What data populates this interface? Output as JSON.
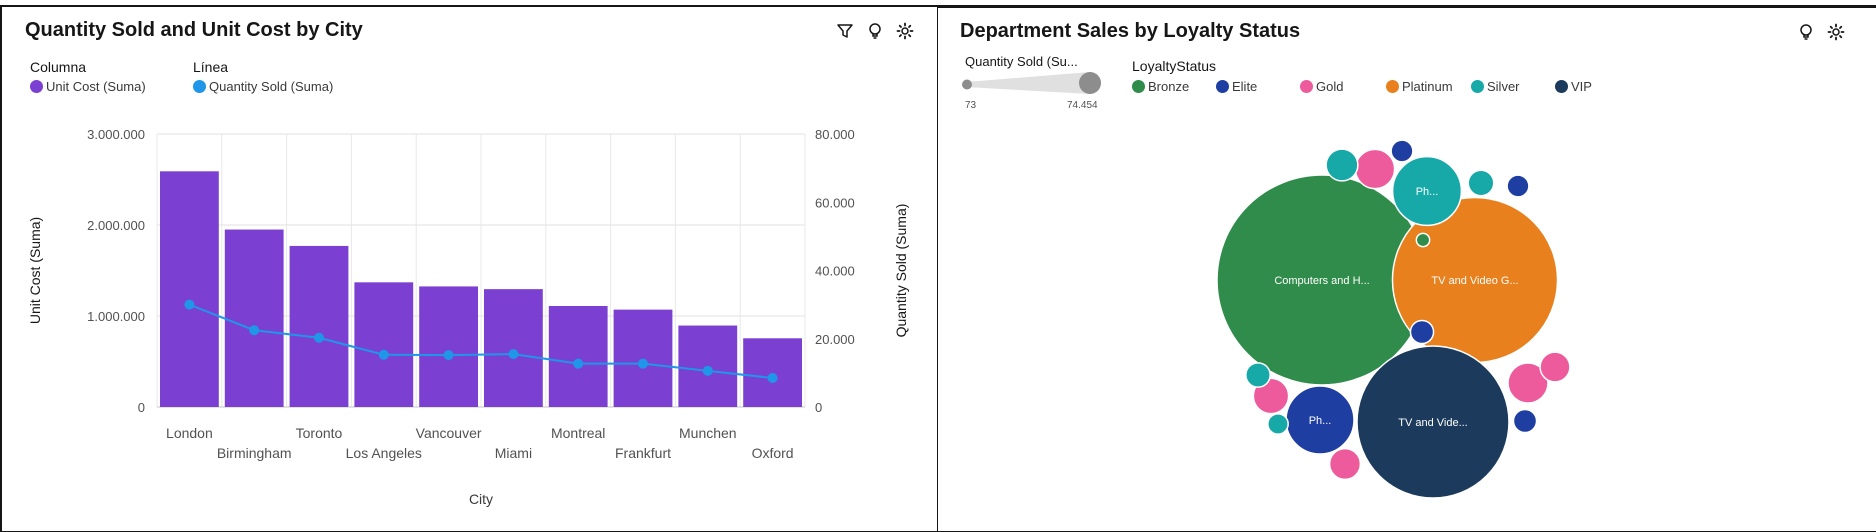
{
  "left_panel": {
    "title": "Quantity Sold and Unit Cost by City",
    "icons": [
      "filter-icon",
      "lightbulb-icon",
      "settings-icon"
    ],
    "legend": {
      "column_heading": "Columna",
      "column_item": "Unit Cost (Suma)",
      "line_heading": "Línea",
      "line_item": "Quantity Sold (Suma)"
    }
  },
  "right_panel": {
    "title": "Department Sales by Loyalty Status",
    "icons": [
      "lightbulb-icon",
      "settings-icon"
    ],
    "size_legend": {
      "title": "Quantity Sold (Su...",
      "min_label": "73",
      "max_label": "74.454"
    },
    "color_legend": {
      "title": "LoyaltyStatus",
      "items": [
        {
          "label": "Bronze",
          "color": "#2f8c4a"
        },
        {
          "label": "Elite",
          "color": "#1f3ea1"
        },
        {
          "label": "Gold",
          "color": "#ee5b9d"
        },
        {
          "label": "Platinum",
          "color": "#e7801d"
        },
        {
          "label": "Silver",
          "color": "#17a9a8"
        },
        {
          "label": "VIP",
          "color": "#1b3a5c"
        }
      ]
    }
  },
  "chart_data": [
    {
      "type": "bar",
      "title": "Quantity Sold and Unit Cost by City",
      "xlabel": "City",
      "ylabel": "Unit Cost (Suma)",
      "y2label": "Quantity Sold (Suma)",
      "categories": [
        "London",
        "Birmingham",
        "Toronto",
        "Los Angeles",
        "Vancouver",
        "Miami",
        "Montreal",
        "Frankfurt",
        "Munchen",
        "Oxford"
      ],
      "series": [
        {
          "name": "Unit Cost (Suma)",
          "type": "bar",
          "axis": "left",
          "color": "#7b3fd1",
          "values": [
            2590000,
            1950000,
            1770000,
            1370000,
            1325000,
            1295000,
            1110000,
            1070000,
            895000,
            755000
          ]
        },
        {
          "name": "Quantity Sold (Suma)",
          "type": "line",
          "axis": "right",
          "color": "#1f96e8",
          "values": [
            30000,
            22500,
            20300,
            15300,
            15200,
            15500,
            12700,
            12700,
            10600,
            8500
          ]
        }
      ],
      "ylim": [
        0,
        3000000
      ],
      "y2lim": [
        0,
        80000
      ],
      "yticks": [
        "0",
        "1.000.000",
        "2.000.000",
        "3.000.000"
      ],
      "y2ticks": [
        "0",
        "20.000",
        "40.000",
        "60.000",
        "80.000"
      ],
      "grid": true
    },
    {
      "type": "bubble",
      "title": "Department Sales by Loyalty Status",
      "size_measure": "Quantity Sold (Su...",
      "color_by": "LoyaltyStatus",
      "bubbles": [
        {
          "label": "Computers and H...",
          "status": "Bronze",
          "value": 74454
        },
        {
          "label": "TV and Video G...",
          "status": "Platinum",
          "value": 46000
        },
        {
          "label": "TV and Vide...",
          "status": "VIP",
          "value": 39000
        },
        {
          "label": "Ph...",
          "status": "Silver",
          "value": 8000
        },
        {
          "label": "Ph...",
          "status": "Elite",
          "value": 7800
        },
        {
          "label": "",
          "status": "Gold",
          "value": 2600
        },
        {
          "label": "",
          "status": "Gold",
          "value": 2700
        },
        {
          "label": "",
          "status": "Gold",
          "value": 2100
        },
        {
          "label": "",
          "status": "Gold",
          "value": 1600
        },
        {
          "label": "",
          "status": "Gold",
          "value": 1500
        },
        {
          "label": "",
          "status": "Silver",
          "value": 1700
        },
        {
          "label": "",
          "status": "Silver",
          "value": 1100
        },
        {
          "label": "",
          "status": "Silver",
          "value": 1000
        },
        {
          "label": "",
          "status": "Silver",
          "value": 700
        },
        {
          "label": "",
          "status": "Elite",
          "value": 800
        },
        {
          "label": "",
          "status": "Elite",
          "value": 800
        },
        {
          "label": "",
          "status": "Elite",
          "value": 900
        },
        {
          "label": "",
          "status": "Elite",
          "value": 900
        },
        {
          "label": "",
          "status": "Bronze",
          "value": 300
        }
      ]
    }
  ]
}
